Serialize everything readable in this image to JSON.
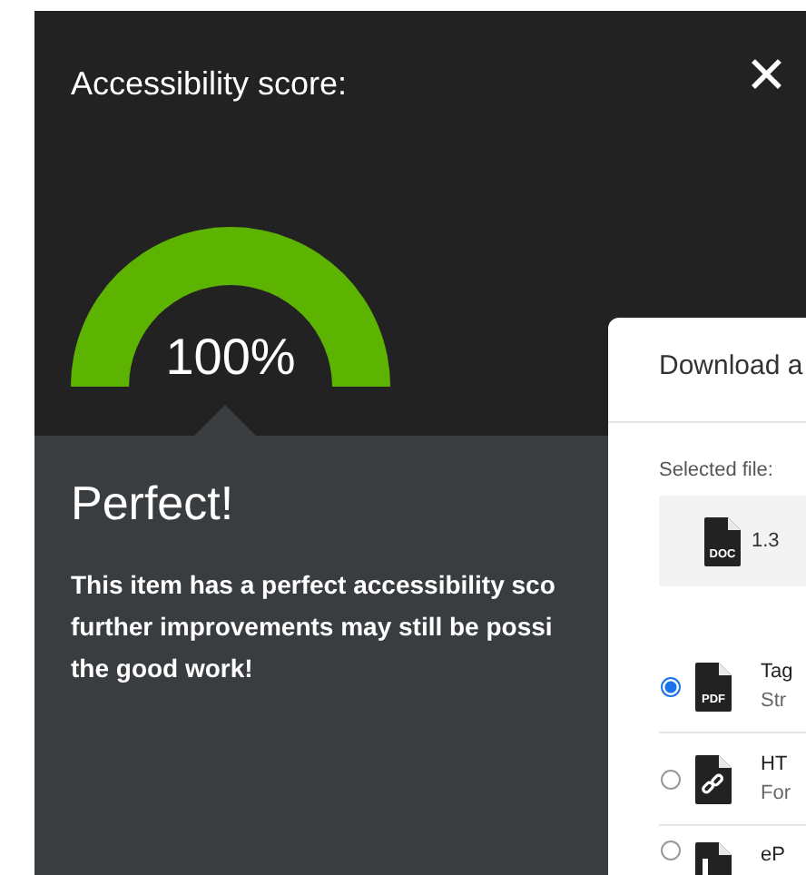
{
  "score_panel": {
    "title": "Accessibility score:",
    "close": "✕",
    "gauge": {
      "reading": "100%"
    },
    "verdict": "Perfect!",
    "message": "This item has a perfect accessibility sco\nfurther improvements may still be possi\nthe good work!"
  },
  "download_dialog": {
    "title": "Download a",
    "selected_label": "Selected file:",
    "selected_file": {
      "badge": "DOC",
      "name": "1.3"
    },
    "formats": [
      {
        "kind": "pdf",
        "badge": "PDF",
        "name": "Tag",
        "description": "Str",
        "selected": true
      },
      {
        "kind": "link",
        "name": "HT",
        "description": "For",
        "selected": false
      },
      {
        "kind": "epub",
        "name": "eP",
        "selected": false
      }
    ]
  }
}
